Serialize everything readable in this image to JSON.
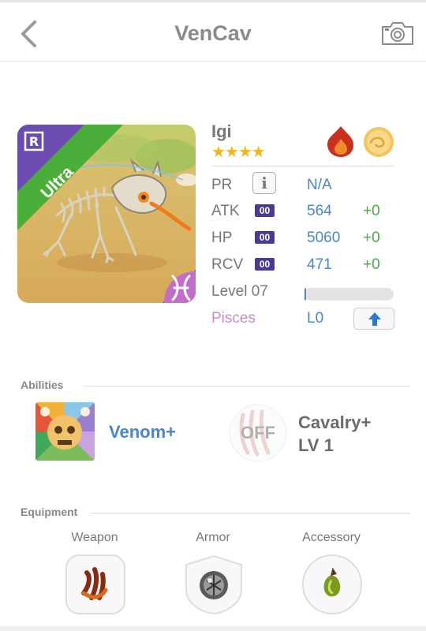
{
  "header": {
    "title": "VenCav",
    "back_icon": "chevron-left-icon",
    "camera_icon": "camera-icon"
  },
  "card": {
    "rarity_label": "Ultra",
    "rarity_badge": "R",
    "zodiac_icon": "pisces-icon",
    "rarity_color": "#4cae3a",
    "corner_color": "#6a4bb0"
  },
  "monster": {
    "name": "Igi",
    "stars": "★★★★",
    "star_count": 4,
    "element_icons": [
      "fire-element-icon",
      "cloud-element-icon"
    ]
  },
  "stats": {
    "pr": {
      "label": "PR",
      "value": "N/A",
      "icon": "info-icon"
    },
    "atk": {
      "label": "ATK",
      "badge": "00",
      "value": "564",
      "bonus": "+0"
    },
    "hp": {
      "label": "HP",
      "badge": "00",
      "value": "5060",
      "bonus": "+0"
    },
    "rcv": {
      "label": "RCV",
      "badge": "00",
      "value": "471",
      "bonus": "+0"
    },
    "level": {
      "label": "Level 07",
      "progress": 0.02
    },
    "sign": {
      "label": "Pisces",
      "value": "L0",
      "upgrade_icon": "arrow-up-icon"
    }
  },
  "abilities": {
    "header": "Abilities",
    "items": [
      {
        "name": "Venom+",
        "icon": "venom-skull-icon"
      },
      {
        "name_line1": "Cavalry+",
        "name_line2": "LV 1",
        "state": "OFF",
        "icon": "claw-icon"
      }
    ]
  },
  "equipment": {
    "header": "Equipment",
    "slots": [
      {
        "label": "Weapon",
        "icon": "weapon-claw-icon"
      },
      {
        "label": "Armor",
        "icon": "armor-orb-icon"
      },
      {
        "label": "Accessory",
        "icon": "accessory-leaf-icon"
      }
    ]
  },
  "colors": {
    "accent_blue": "#4a86c7",
    "plus_green": "#4aa84a",
    "pisces_pink": "#c98bc8",
    "badge_purple": "#4a3a98",
    "star_gold": "#f3b51c"
  }
}
